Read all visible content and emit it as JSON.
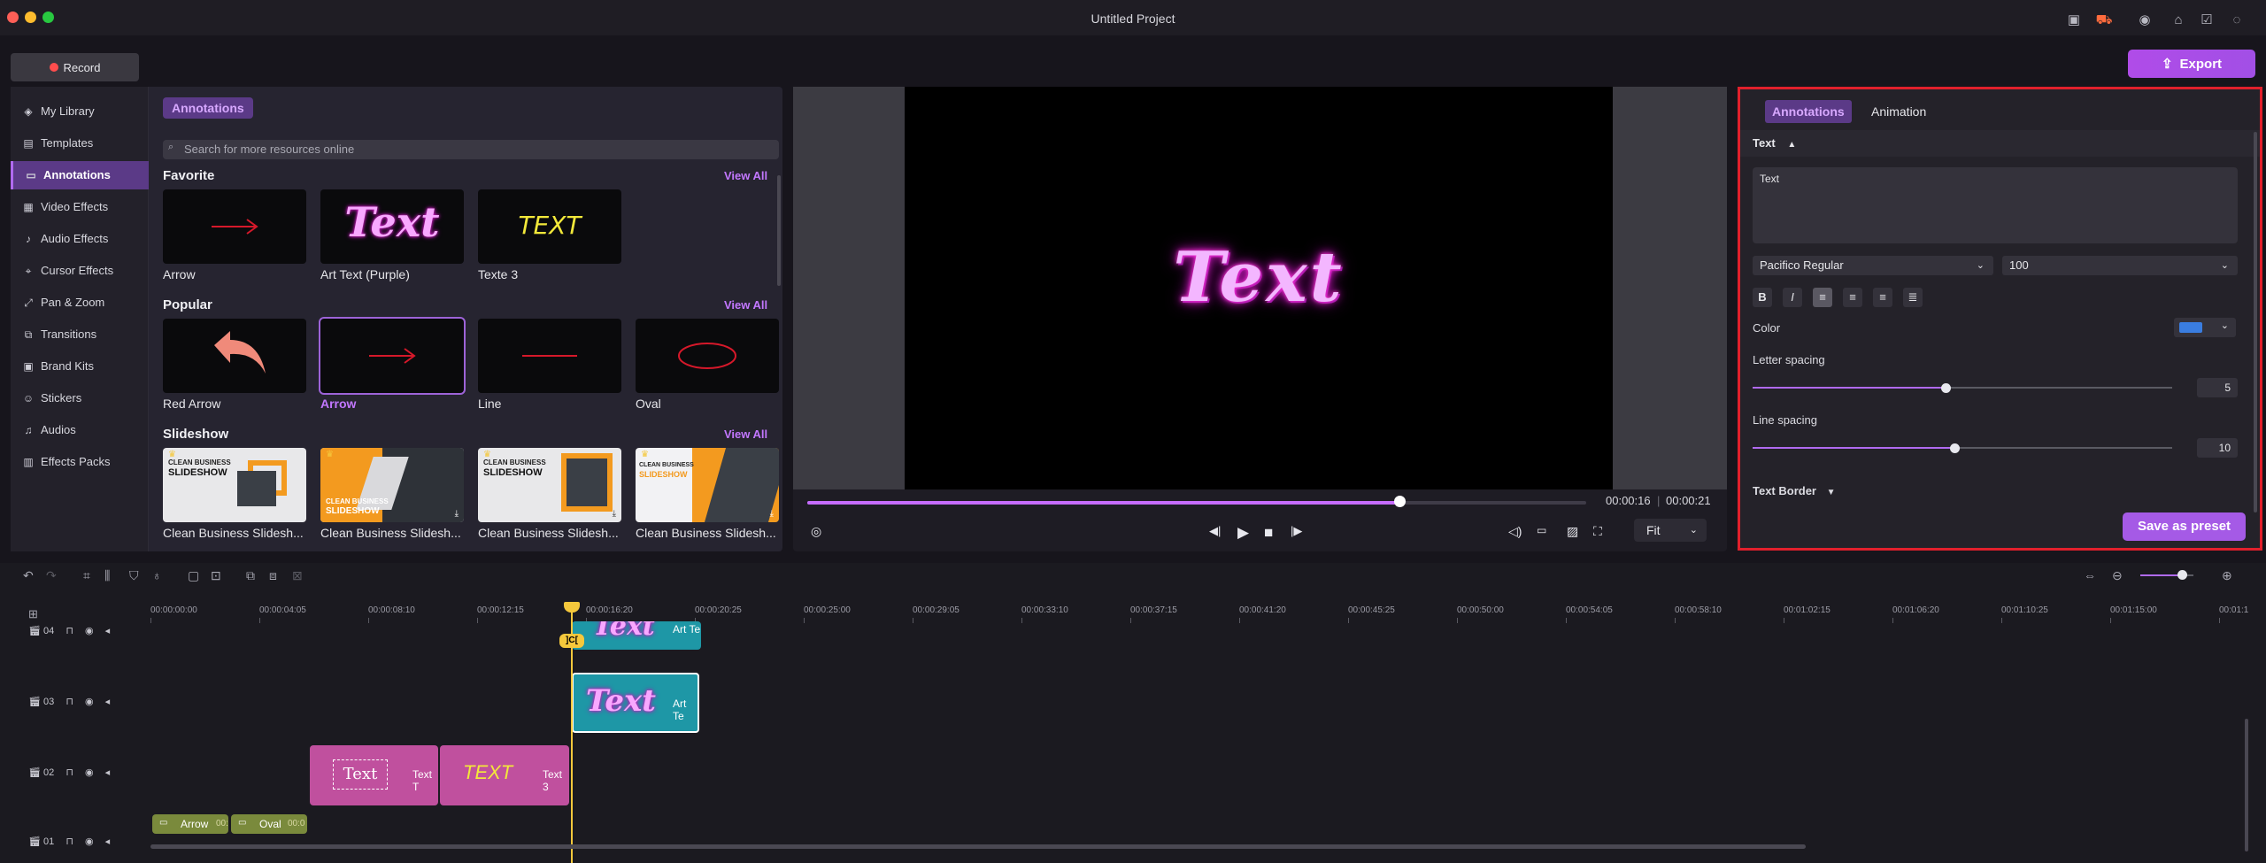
{
  "window": {
    "title": "Untitled Project"
  },
  "toolbar": {
    "record_label": "Record",
    "export_label": "Export"
  },
  "sidebar": {
    "items": [
      {
        "label": "My Library",
        "icon": "layers-icon"
      },
      {
        "label": "Templates",
        "icon": "template-icon"
      },
      {
        "label": "Annotations",
        "icon": "annotation-icon",
        "active": true
      },
      {
        "label": "Video Effects",
        "icon": "film-icon"
      },
      {
        "label": "Audio Effects",
        "icon": "music-icon"
      },
      {
        "label": "Cursor Effects",
        "icon": "cursor-icon"
      },
      {
        "label": "Pan & Zoom",
        "icon": "pan-zoom-icon"
      },
      {
        "label": "Transitions",
        "icon": "transition-icon"
      },
      {
        "label": "Brand Kits",
        "icon": "brand-icon"
      },
      {
        "label": "Stickers",
        "icon": "sticker-icon"
      },
      {
        "label": "Audios",
        "icon": "audio-icon"
      },
      {
        "label": "Effects Packs",
        "icon": "pack-icon"
      }
    ]
  },
  "library": {
    "tag": "Annotations",
    "search_placeholder": "Search for more resources online",
    "sections": [
      {
        "title": "Favorite",
        "view_all": "View All",
        "items": [
          "Arrow",
          "Art Text (Purple)",
          "Texte 3"
        ]
      },
      {
        "title": "Popular",
        "view_all": "View All",
        "items": [
          "Red Arrow",
          "Arrow",
          "Line",
          "Oval"
        ]
      },
      {
        "title": "Slideshow",
        "view_all": "View All",
        "items": [
          "Clean Business Slidesh...",
          "Clean Business Slidesh...",
          "Clean Business Slidesh...",
          "Clean Business Slidesh..."
        ]
      }
    ],
    "thumb_text": {
      "art": "Text",
      "texte3": "TEXT",
      "slide_small": "CLEAN BUSINESS",
      "slide_big": "SLIDESHOW"
    }
  },
  "preview": {
    "overlay_text": "Text",
    "current_time": "00:00:16",
    "total_time": "00:00:21",
    "progress": 0.76,
    "fit": "Fit"
  },
  "properties": {
    "tabs": [
      "Annotations",
      "Animation"
    ],
    "section": "Text",
    "text_value": "Text",
    "font": "Pacifico Regular",
    "font_size": "100",
    "color_label": "Color",
    "color": "#3a7de0",
    "letter_spacing_label": "Letter spacing",
    "letter_spacing": "5",
    "letter_spacing_level": 0.46,
    "line_spacing_label": "Line spacing",
    "line_spacing": "10",
    "line_spacing_level": 0.48,
    "border_section": "Text Border",
    "save_preset": "Save as preset"
  },
  "timeline": {
    "ruler": [
      "00:00:00:00",
      "00:00:04:05",
      "00:00:08:10",
      "00:00:12:15",
      "00:00:16:20",
      "00:00:20:25",
      "00:00:25:00",
      "00:00:29:05",
      "00:00:33:10",
      "00:00:37:15",
      "00:00:41:20",
      "00:00:45:25",
      "00:00:50:00",
      "00:00:54:05",
      "00:00:58:10",
      "00:01:02:15",
      "00:01:06:20",
      "00:01:10:25",
      "00:01:15:00",
      "00:01:1"
    ],
    "tracks": [
      "04",
      "03",
      "02",
      "01"
    ],
    "playhead_badge": "]C[",
    "clips": {
      "t04_label": "Art Te",
      "t04_text": "Text",
      "t03_label": "Art Te",
      "t03_text": "Text",
      "t02a_label": "Text T",
      "t02a_text": "Text",
      "t02b_label": "Text 3",
      "t02b_text": "TEXT",
      "t01a_label": "Arrow",
      "t01a_time": "00:",
      "t01b_label": "Oval",
      "t01b_time": "00:0"
    }
  }
}
